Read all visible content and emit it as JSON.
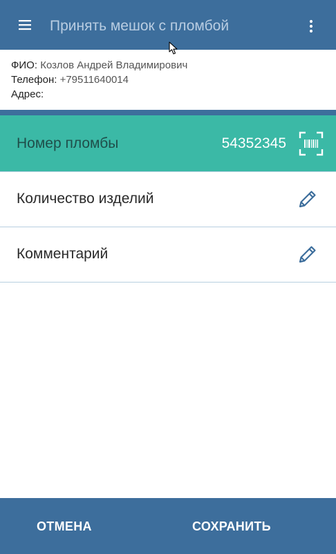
{
  "header": {
    "title": "Принять мешок с пломбой",
    "menu_icon": "hamburger-menu-icon",
    "more_icon": "more-vert-icon"
  },
  "customer": {
    "fio_label": "ФИО:",
    "fio_value": "Козлов Андрей Владимирович",
    "phone_label": "Телефон:",
    "phone_value": "+79511640014",
    "address_label": "Адрес:",
    "address_value": ""
  },
  "seal": {
    "label": "Номер пломбы",
    "value": "54352345",
    "scan_icon": "barcode-scan-icon"
  },
  "fields": [
    {
      "label": "Количество изделий",
      "icon": "pencil-edit-icon"
    },
    {
      "label": "Комментарий",
      "icon": "pencil-edit-icon"
    }
  ],
  "footer": {
    "cancel_label": "ОТМЕНА",
    "save_label": "СОХРАНИТЬ"
  },
  "colors": {
    "primary": "#3d6e9c",
    "accent": "#3bb9a6",
    "divider": "#b8cfe0"
  }
}
